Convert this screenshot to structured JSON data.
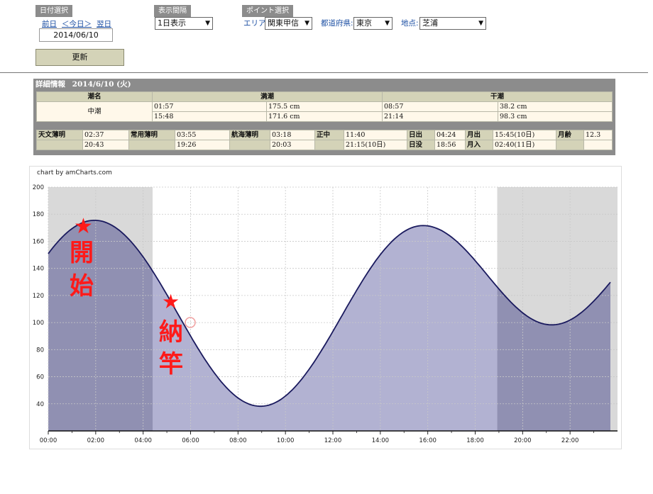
{
  "controls": {
    "date_panel_title": "日付選択",
    "prev_label": "前日",
    "today_label": "＜今日＞",
    "next_label": "翌日",
    "date_value": "2014/06/10",
    "update_label": "更新",
    "interval_panel_title": "表示間隔",
    "interval_value": "1日表示",
    "point_panel_title": "ポイント選択",
    "area_label": "エリア:",
    "area_value": "関東甲信",
    "pref_label": "都道府県:",
    "pref_value": "東京",
    "place_label": "地点:",
    "place_value": "芝浦"
  },
  "detail": {
    "heading": "詳細情報",
    "heading_date": "2014/6/10 (火)",
    "col_tide_name": "潮名",
    "col_high": "満潮",
    "col_low": "干潮",
    "tide_name": "中潮",
    "high": [
      {
        "time": "01:57",
        "level": "175.5 cm"
      },
      {
        "time": "15:48",
        "level": "171.6 cm"
      }
    ],
    "low": [
      {
        "time": "08:57",
        "level": "38.2 cm"
      },
      {
        "time": "21:14",
        "level": "98.3 cm"
      }
    ],
    "astro_twilight_label": "天文薄明",
    "astro_twilight": [
      "02:37",
      "20:43"
    ],
    "civil_twilight_label": "常用薄明",
    "civil_twilight": [
      "03:55",
      "19:26"
    ],
    "nautical_twilight_label": "航海薄明",
    "nautical_twilight": [
      "03:18",
      "20:03"
    ],
    "transit_label": "正中",
    "transit": [
      "11:40",
      "21:15(10日)"
    ],
    "sunrise_label": "日出",
    "sunrise": "04:24",
    "sunset_label": "日没",
    "sunset": "18:56",
    "moonrise_label": "月出",
    "moonrise": "15:45(10日)",
    "moonset_label": "月入",
    "moonset": "02:40(11日)",
    "moon_age_label": "月齢",
    "moon_age": "12.3"
  },
  "annotations": {
    "start_text": "開始",
    "end_text": "納竿",
    "star_glyph": "★"
  },
  "chart_data": {
    "type": "area",
    "credit": "chart by amCharts.com",
    "x_unit": "hour",
    "x_range": [
      0,
      24
    ],
    "ylim": [
      20,
      200
    ],
    "yticks": [
      40,
      60,
      80,
      100,
      120,
      140,
      160,
      180,
      200
    ],
    "xtick_labels": [
      "00:00",
      "02:00",
      "04:00",
      "06:00",
      "08:00",
      "10:00",
      "12:00",
      "14:00",
      "16:00",
      "18:00",
      "20:00",
      "22:00"
    ],
    "xtick_hours": [
      0,
      2,
      4,
      6,
      8,
      10,
      12,
      14,
      16,
      18,
      20,
      22
    ],
    "extrema": [
      {
        "time": "01:57",
        "hour": 1.95,
        "value": 175.5
      },
      {
        "time": "08:57",
        "hour": 8.95,
        "value": 38.2
      },
      {
        "time": "15:48",
        "hour": 15.8,
        "value": 171.6
      },
      {
        "time": "21:14",
        "hour": 21.23,
        "value": 98.3
      }
    ],
    "start_value": 156,
    "end_value": 139,
    "night_bands": [
      {
        "from": 0,
        "to": 4.4
      },
      {
        "from": 18.93,
        "to": 24
      }
    ],
    "grid": true,
    "colors": {
      "line": "#1a1a5e",
      "fill_day": "#b2b2d2",
      "fill_night": "#9090b2",
      "night_band": "#d9d9d9",
      "annotation": "#ff1a1a"
    }
  }
}
